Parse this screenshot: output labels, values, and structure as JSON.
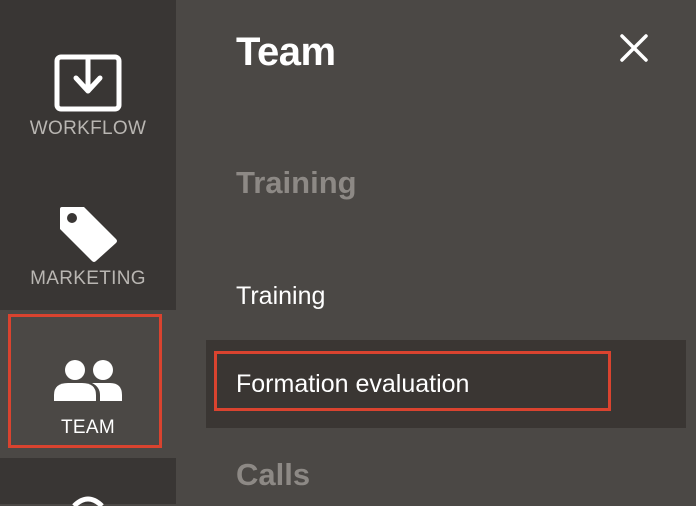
{
  "sidebar": {
    "items": [
      {
        "label": "WORKFLOW",
        "icon": "download-box-icon"
      },
      {
        "label": "MARKETING",
        "icon": "tag-icon"
      },
      {
        "label": "TEAM",
        "icon": "people-icon",
        "selected": true
      },
      {
        "label": "",
        "icon": "partial-icon"
      }
    ]
  },
  "panel": {
    "title": "Team",
    "close_icon": "close-icon",
    "sections": [
      {
        "heading": "Training",
        "items": [
          {
            "label": "Training"
          },
          {
            "label": "Formation evaluation",
            "hovered": true
          }
        ]
      },
      {
        "heading": "Calls",
        "items": []
      }
    ]
  },
  "colors": {
    "sidebar_bg": "#393634",
    "panel_bg": "#4b4845",
    "hover_bg": "#3a3633",
    "highlight": "#d9432f",
    "heading_muted": "#8d8985"
  }
}
